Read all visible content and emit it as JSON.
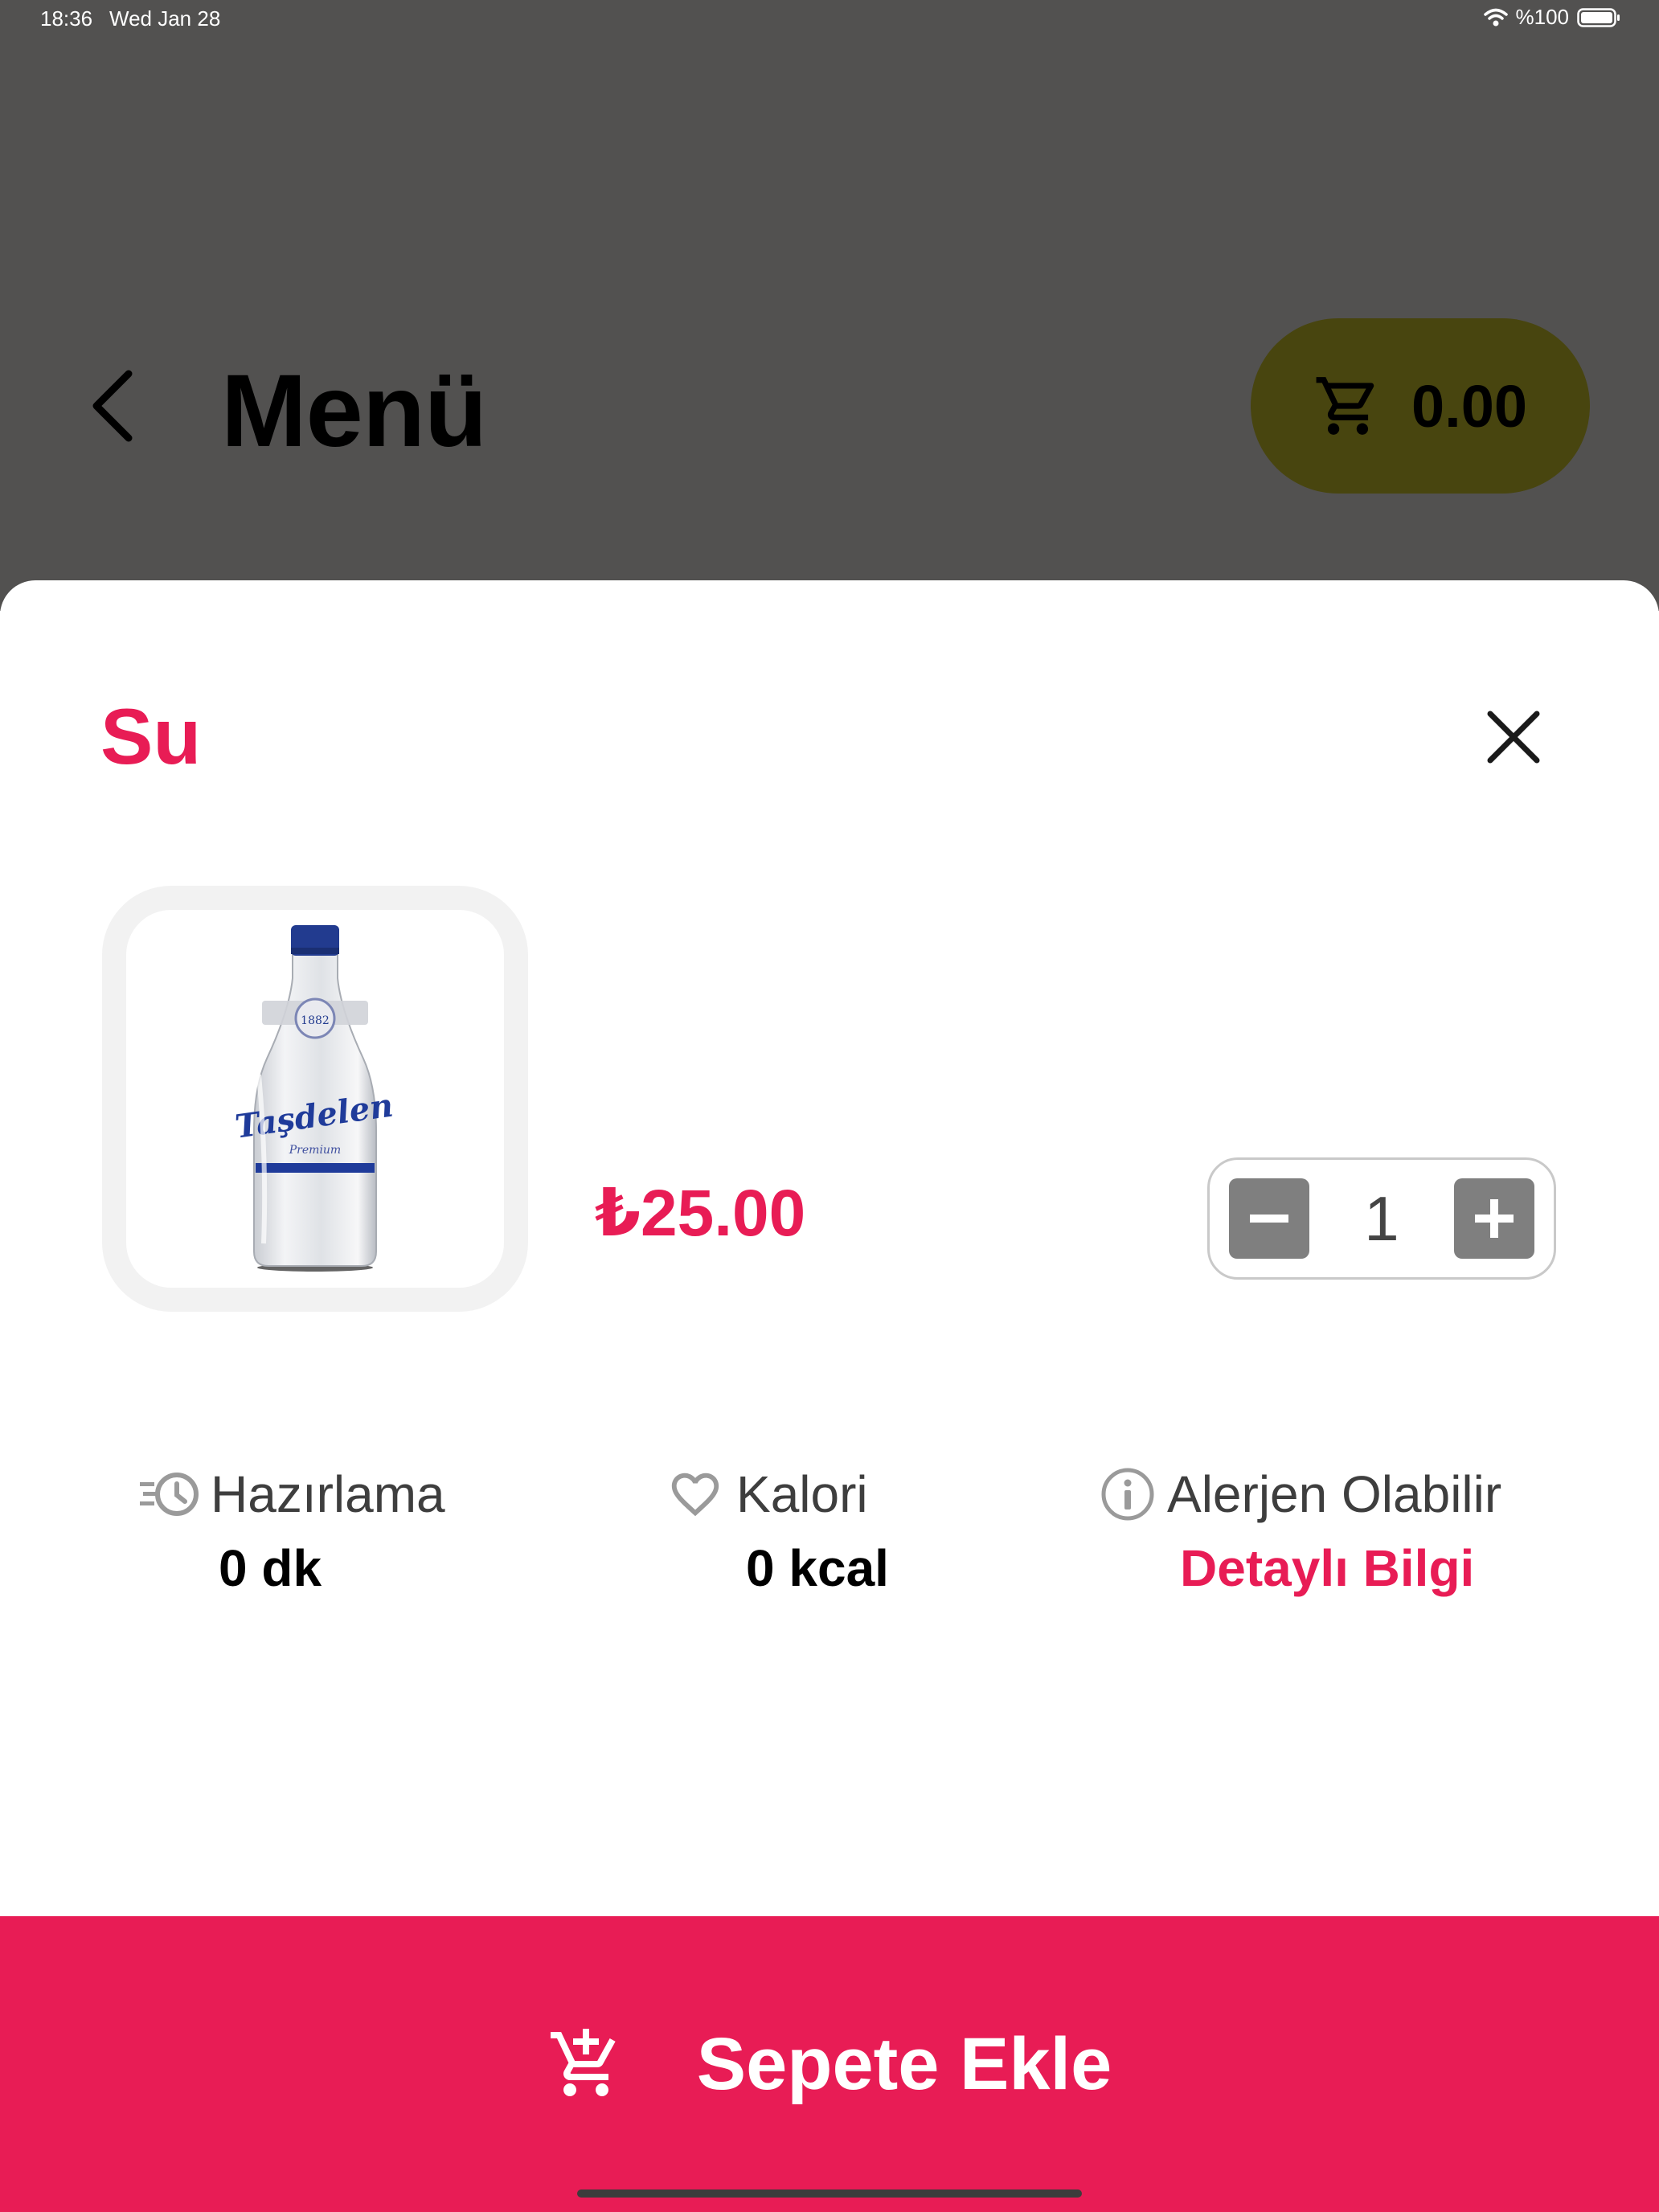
{
  "status_bar": {
    "time": "18:36",
    "date": "Wed Jan 28",
    "battery": "%100"
  },
  "background_page": {
    "title": "Menü",
    "cart_total": "0.00"
  },
  "product": {
    "name": "Su",
    "price": "₺25.00",
    "quantity": "1",
    "image_alt": "water-bottle"
  },
  "info": {
    "preparation": {
      "label": "Hazırlama",
      "value": "0 dk"
    },
    "calories": {
      "label": "Kalori",
      "value": "0 kcal"
    },
    "allergen": {
      "label": "Alerjen Olabilir",
      "link": "Detaylı Bilgi"
    }
  },
  "actions": {
    "add_to_cart": "Sepete Ekle"
  },
  "colors": {
    "accent": "#e81c55",
    "dim_background": "#525150",
    "cart_pill": "#48450f"
  },
  "icons": [
    "wifi-icon",
    "battery-icon",
    "back-chevron-icon",
    "cart-icon",
    "close-icon",
    "minus-icon",
    "plus-icon",
    "timer-icon",
    "heart-icon",
    "info-icon",
    "add-to-cart-icon"
  ]
}
